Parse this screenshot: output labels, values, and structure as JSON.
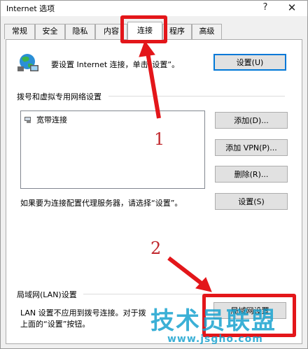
{
  "window": {
    "title": "Internet 选项",
    "help": "?",
    "close": "✕"
  },
  "tabs": [
    {
      "label": "常规"
    },
    {
      "label": "安全"
    },
    {
      "label": "隐私"
    },
    {
      "label": "内容"
    },
    {
      "label": "连接"
    },
    {
      "label": "程序"
    },
    {
      "label": "高级"
    }
  ],
  "active_tab": "连接",
  "setup": {
    "text": "要设置 Internet 连接，单击“设置”。",
    "button": "设置(U)",
    "icon": "globe-network-icon"
  },
  "dialup": {
    "heading": "拨号和虚拟专用网络设置",
    "items": [
      {
        "label": "宽带连接",
        "icon": "network-connection-icon"
      }
    ],
    "add_button": "添加(D)...",
    "add_vpn_button": "添加 VPN(P)...",
    "remove_button": "删除(R)...",
    "proxy_text": "如果要为连接配置代理服务器，请选择“设置”。",
    "settings_button": "设置(S)"
  },
  "lan": {
    "heading": "局域网(LAN)设置",
    "text_line1": "LAN 设置不应用到拨号连接。对于拨",
    "text_line2": "上面的“设置”按钮。",
    "button": "局域网设置"
  },
  "annotations": {
    "num1": "1",
    "num2": "2",
    "color": "#e3161a"
  },
  "watermark": {
    "logo": "技术员联盟",
    "url": "www.jsgho.com"
  }
}
